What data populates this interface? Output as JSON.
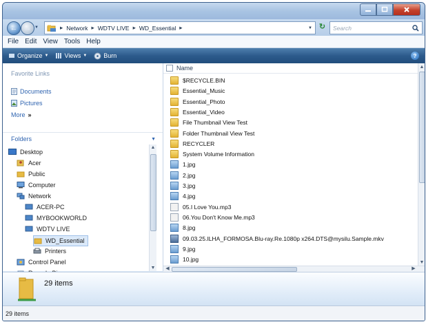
{
  "window": {
    "colors": {
      "title_bar": "#a9c4e3",
      "toolbar": "#2d5b8c",
      "close": "#c4422b",
      "selection": "#dbe9f9",
      "folder": "#e3b334"
    }
  },
  "address_bar": {
    "crumbs": [
      "Network",
      "WDTV LIVE",
      "WD_Essential"
    ],
    "search_placeholder": "Search"
  },
  "menu": [
    "File",
    "Edit",
    "View",
    "Tools",
    "Help"
  ],
  "toolbar": {
    "organize": "Organize",
    "views": "Views",
    "burn": "Burn"
  },
  "nav_pane": {
    "favorites_title": "Favorite Links",
    "favorites": [
      "Documents",
      "Pictures",
      "More"
    ],
    "folders_title": "Folders",
    "tree": [
      "Desktop",
      "Acer",
      "Public",
      "Computer",
      "Network",
      "ACER-PC",
      "MYBOOKWORLD",
      "WDTV LIVE",
      "WD_Essential",
      "Printers",
      "Control Panel",
      "Recycle Bin"
    ],
    "selected": "WD_Essential"
  },
  "content": {
    "column_header": "Name",
    "files": [
      {
        "name": "$RECYCLE.BIN",
        "type": "folder"
      },
      {
        "name": "Essential_Music",
        "type": "folder"
      },
      {
        "name": "Essential_Photo",
        "type": "folder"
      },
      {
        "name": "Essential_Video",
        "type": "folder"
      },
      {
        "name": "File Thumbnail View Test",
        "type": "folder"
      },
      {
        "name": "Folder Thumbnail View Test",
        "type": "folder"
      },
      {
        "name": "RECYCLER",
        "type": "folder"
      },
      {
        "name": "System Volume Information",
        "type": "folder"
      },
      {
        "name": "1.jpg",
        "type": "jpg"
      },
      {
        "name": "2.jpg",
        "type": "jpg"
      },
      {
        "name": "3.jpg",
        "type": "jpg"
      },
      {
        "name": "4.jpg",
        "type": "jpg"
      },
      {
        "name": "05.I Love You.mp3",
        "type": "mp3"
      },
      {
        "name": "06.You Don't Know Me.mp3",
        "type": "mp3"
      },
      {
        "name": "8.jpg",
        "type": "jpg"
      },
      {
        "name": "09.03.25.ILHA_FORMOSA.Blu-ray.Re.1080p x264.DTS@mysilu.Sample.mkv",
        "type": "mkv"
      },
      {
        "name": "9.jpg",
        "type": "jpg"
      },
      {
        "name": "10.jpg",
        "type": "jpg"
      }
    ]
  },
  "details_pane": {
    "item_count": "29 items"
  },
  "status_bar": {
    "text": "29 items"
  }
}
